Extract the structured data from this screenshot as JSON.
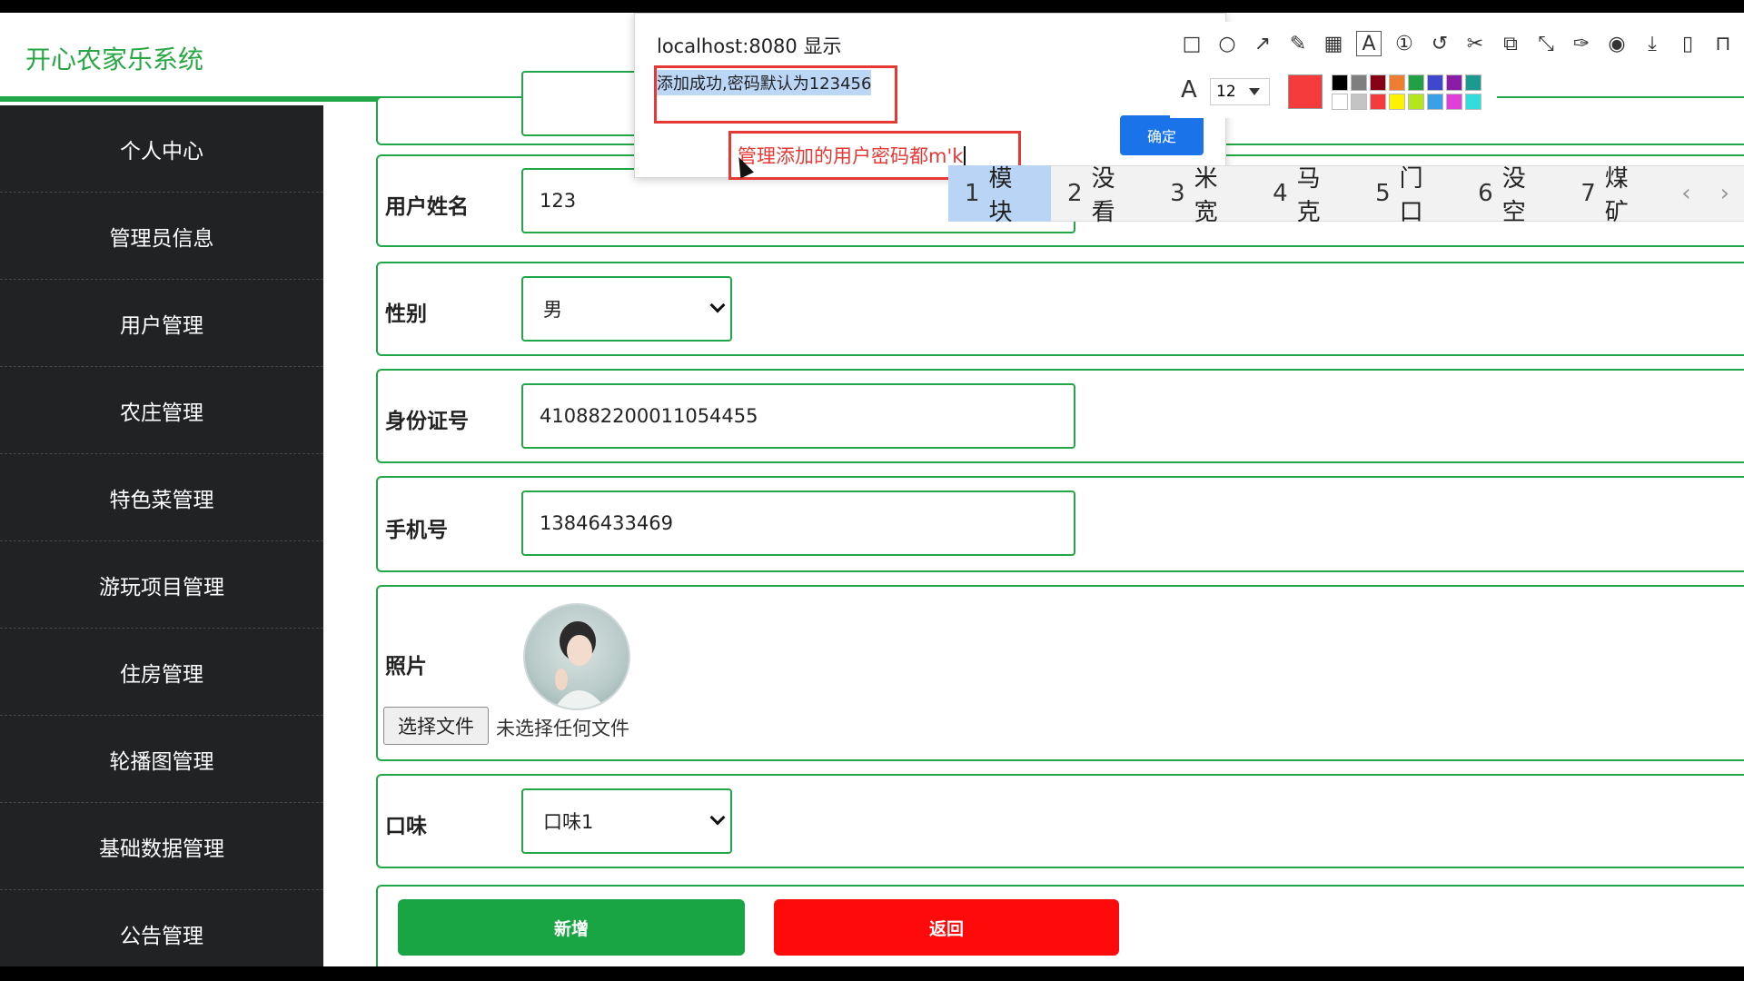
{
  "app": {
    "brand": "开心农家乐系统"
  },
  "sidebar": {
    "items": [
      {
        "label": "个人中心"
      },
      {
        "label": "管理员信息"
      },
      {
        "label": "用户管理"
      },
      {
        "label": "农庄管理"
      },
      {
        "label": "特色菜管理"
      },
      {
        "label": "游玩项目管理"
      },
      {
        "label": "住房管理"
      },
      {
        "label": "轮播图管理"
      },
      {
        "label": "基础数据管理"
      },
      {
        "label": "公告管理"
      }
    ]
  },
  "form": {
    "name": {
      "label": "用户姓名",
      "value": "123"
    },
    "gender": {
      "label": "性别",
      "value": "男"
    },
    "id_number": {
      "label": "身份证号",
      "value": "410882200011054455"
    },
    "phone": {
      "label": "手机号",
      "value": "13846433469"
    },
    "photo": {
      "label": "照片",
      "file_button": "选择文件",
      "file_status": "未选择任何文件"
    },
    "taste": {
      "label": "口味",
      "value": "口味1"
    },
    "add_button": "新增",
    "back_button": "返回"
  },
  "dialog": {
    "title": "localhost:8080 显示",
    "message": "添加成功,密码默认为123456",
    "ok_button": "确定",
    "annotation_text": "管理添加的用户密码都m'k"
  },
  "toolbar": {
    "tools": [
      "rectangle-icon",
      "circle-icon",
      "arrow-icon",
      "pencil-icon",
      "mosaic-icon",
      "text-icon",
      "number-icon",
      "undo-icon",
      "cut-icon",
      "translate-icon",
      "long-screenshot-icon",
      "pin-icon",
      "record-icon",
      "download-icon",
      "phone-icon",
      "bookmark-icon"
    ],
    "font_size": "12",
    "current_color": "#f43a3a",
    "palette": [
      "#000000",
      "#7f7f7f",
      "#880015",
      "#ed7d31",
      "#22a046",
      "#3f48cc",
      "#8b1ca8",
      "#1d9a8f",
      "#ffffff",
      "#c3c3c3",
      "#f43a3a",
      "#fff200",
      "#b5e61d",
      "#3ca0e8",
      "#e040d9",
      "#33dddd"
    ]
  },
  "ime": {
    "candidates": [
      {
        "num": "1",
        "text": "模块"
      },
      {
        "num": "2",
        "text": "没看"
      },
      {
        "num": "3",
        "text": "米宽"
      },
      {
        "num": "4",
        "text": "马克"
      },
      {
        "num": "5",
        "text": "门口"
      },
      {
        "num": "6",
        "text": "没空"
      },
      {
        "num": "7",
        "text": "煤矿"
      }
    ],
    "prev": "‹",
    "next": "›"
  }
}
